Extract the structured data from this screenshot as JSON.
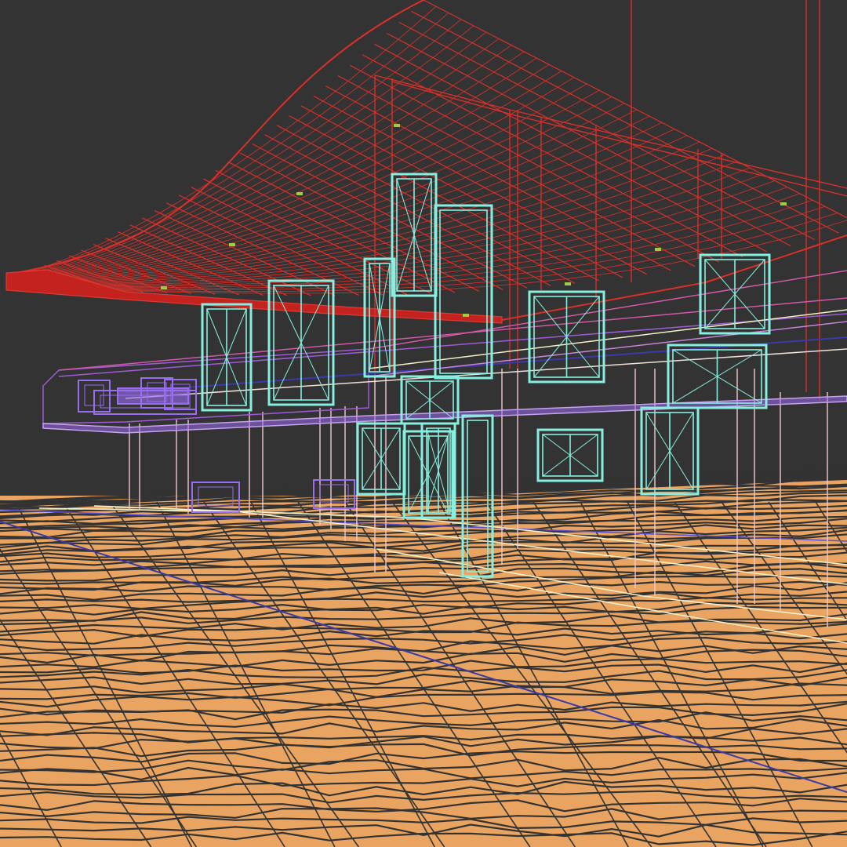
{
  "viewport": {
    "mode": "wireframe",
    "background": "#333333"
  },
  "layers": [
    {
      "name": "roof-canopy",
      "color": "#d9302a"
    },
    {
      "name": "ground-terrain",
      "color": "#e8a460"
    },
    {
      "name": "window-frames",
      "color": "#86efe0"
    },
    {
      "name": "balcony-railing",
      "color": "#a05ad8"
    },
    {
      "name": "support-columns",
      "color": "#f0c8d0"
    },
    {
      "name": "floor-slab-edges",
      "color": "#f4f0c8"
    },
    {
      "name": "patio-furniture",
      "color": "#9a6cf0"
    },
    {
      "name": "grid-axes",
      "color": "#3a3aa8"
    }
  ]
}
